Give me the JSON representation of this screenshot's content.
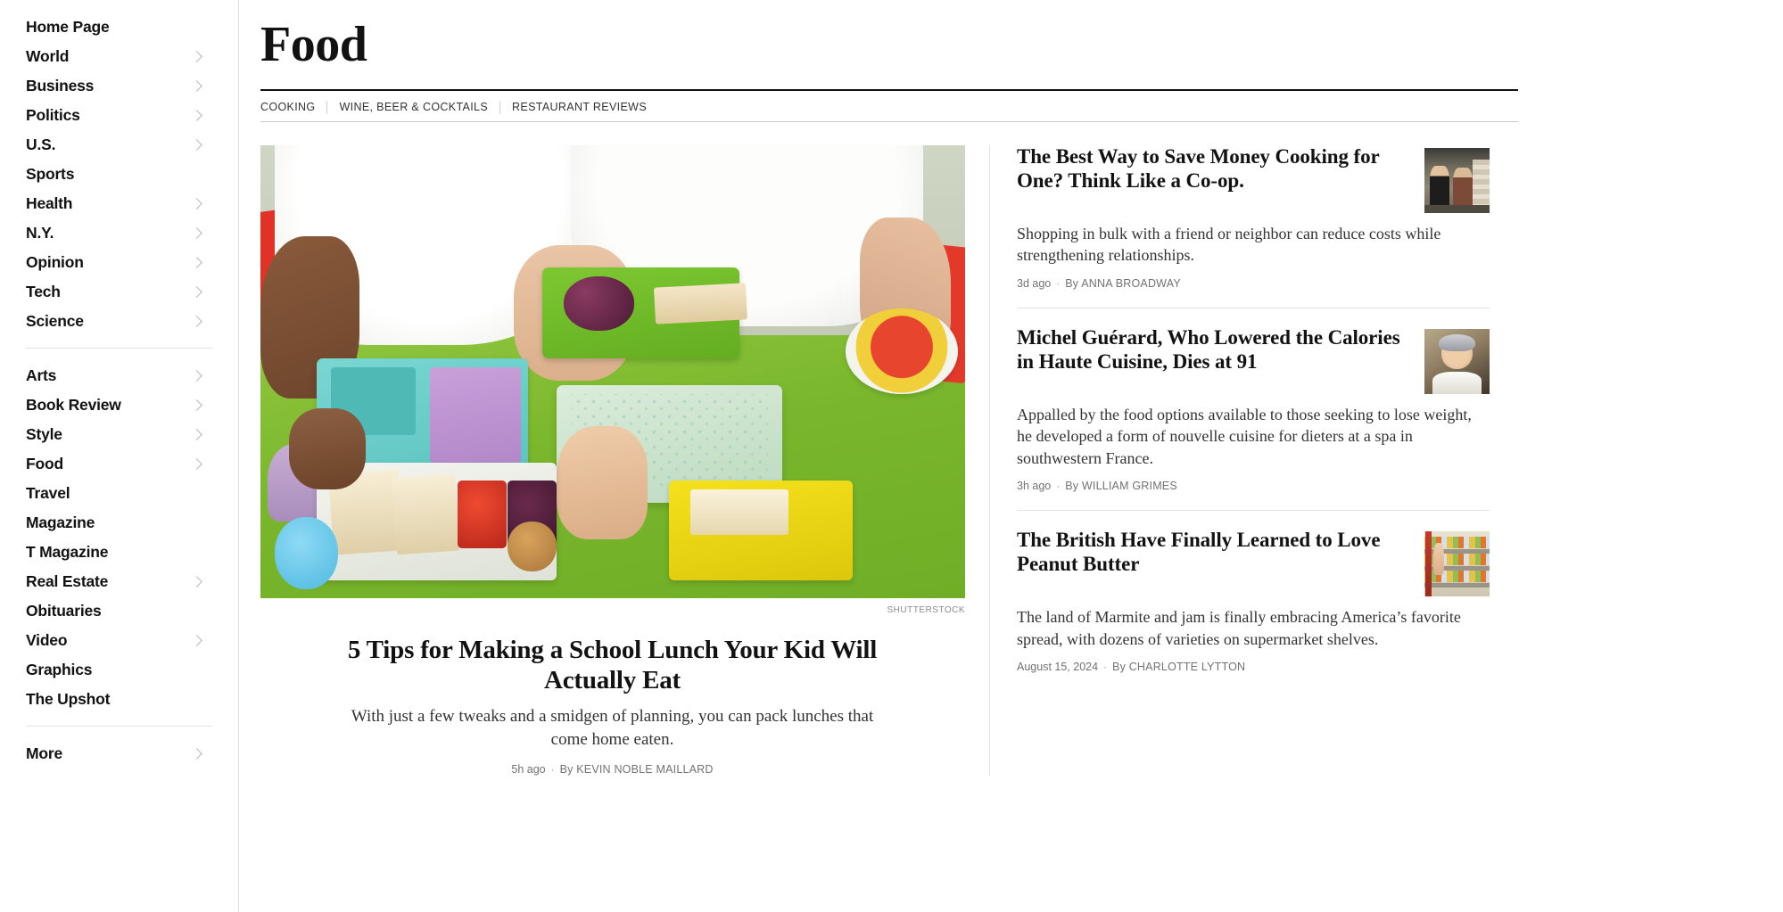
{
  "sidebar": {
    "groups": [
      {
        "items": [
          {
            "label": "Home Page",
            "has_chevron": false
          },
          {
            "label": "World",
            "has_chevron": true
          },
          {
            "label": "Business",
            "has_chevron": true
          },
          {
            "label": "Politics",
            "has_chevron": true
          },
          {
            "label": "U.S.",
            "has_chevron": true
          },
          {
            "label": "Sports",
            "has_chevron": false
          },
          {
            "label": "Health",
            "has_chevron": true
          },
          {
            "label": "N.Y.",
            "has_chevron": true
          },
          {
            "label": "Opinion",
            "has_chevron": true
          },
          {
            "label": "Tech",
            "has_chevron": true
          },
          {
            "label": "Science",
            "has_chevron": true
          }
        ]
      },
      {
        "items": [
          {
            "label": "Arts",
            "has_chevron": true
          },
          {
            "label": "Book Review",
            "has_chevron": true
          },
          {
            "label": "Style",
            "has_chevron": true
          },
          {
            "label": "Food",
            "has_chevron": true
          },
          {
            "label": "Travel",
            "has_chevron": false
          },
          {
            "label": "Magazine",
            "has_chevron": false
          },
          {
            "label": "T Magazine",
            "has_chevron": false
          },
          {
            "label": "Real Estate",
            "has_chevron": true
          },
          {
            "label": "Obituaries",
            "has_chevron": false
          },
          {
            "label": "Video",
            "has_chevron": true
          },
          {
            "label": "Graphics",
            "has_chevron": false
          },
          {
            "label": "The Upshot",
            "has_chevron": false
          }
        ]
      },
      {
        "items": [
          {
            "label": "More",
            "has_chevron": true
          }
        ]
      }
    ]
  },
  "masthead": {
    "section_title": "Food",
    "subnav": [
      {
        "label": "COOKING"
      },
      {
        "label": "WINE, BEER & COCKTAILS"
      },
      {
        "label": "RESTAURANT REVIEWS"
      }
    ]
  },
  "lead_story": {
    "image_alt": "Schoolchildren at a green table with open bento lunch boxes containing sandwiches, grapes, cherry tomatoes and corn",
    "credit": "SHUTTERSTOCK",
    "headline": "5 Tips for Making a School Lunch Your Kid Will Actually Eat",
    "summary": "With just a few tweaks and a smidgen of planning, you can pack lunches that come home eaten.",
    "time": "5h ago",
    "separator": "·",
    "byline": "By KEVIN NOBLE MAILLARD"
  },
  "side_stories": [
    {
      "headline": "The Best Way to Save Money Cooking for One? Think Like a Co-op.",
      "summary": "Shopping in bulk with a friend or neighbor can reduce costs while strengthening relationships.",
      "time": "3d ago",
      "separator": "·",
      "byline": "By ANNA BROADWAY",
      "thumb_alt": "Two shoppers standing beside a cart in a supermarket aisle",
      "thumb_kind": "t1"
    },
    {
      "headline": "Michel Guérard, Who Lowered the Calories in Haute Cuisine, Dies at 91",
      "summary": "Appalled by the food options available to those seeking to lose weight, he developed a form of nouvelle cuisine for dieters at a spa in southwestern France.",
      "time": "3h ago",
      "separator": "·",
      "byline": "By WILLIAM GRIMES",
      "thumb_alt": "Portrait of a smiling grey-haired chef in white chef's whites",
      "thumb_kind": "t2"
    },
    {
      "headline": "The British Have Finally Learned to Love Peanut Butter",
      "summary": "The land of Marmite and jam is finally embracing America’s favorite spread, with dozens of varieties on supermarket shelves.",
      "time": "August 15, 2024",
      "separator": "·",
      "byline": "By CHARLOTTE LYTTON",
      "thumb_alt": "A hand reaching for a jar on a stocked supermarket shelf",
      "thumb_kind": "t3"
    }
  ],
  "colors": {
    "text_primary": "#121212",
    "text_secondary": "#333333",
    "text_meta": "#727272",
    "rule": "#e2e2e2",
    "rule_strong": "#121212",
    "chevron": "#b8b8b8"
  }
}
